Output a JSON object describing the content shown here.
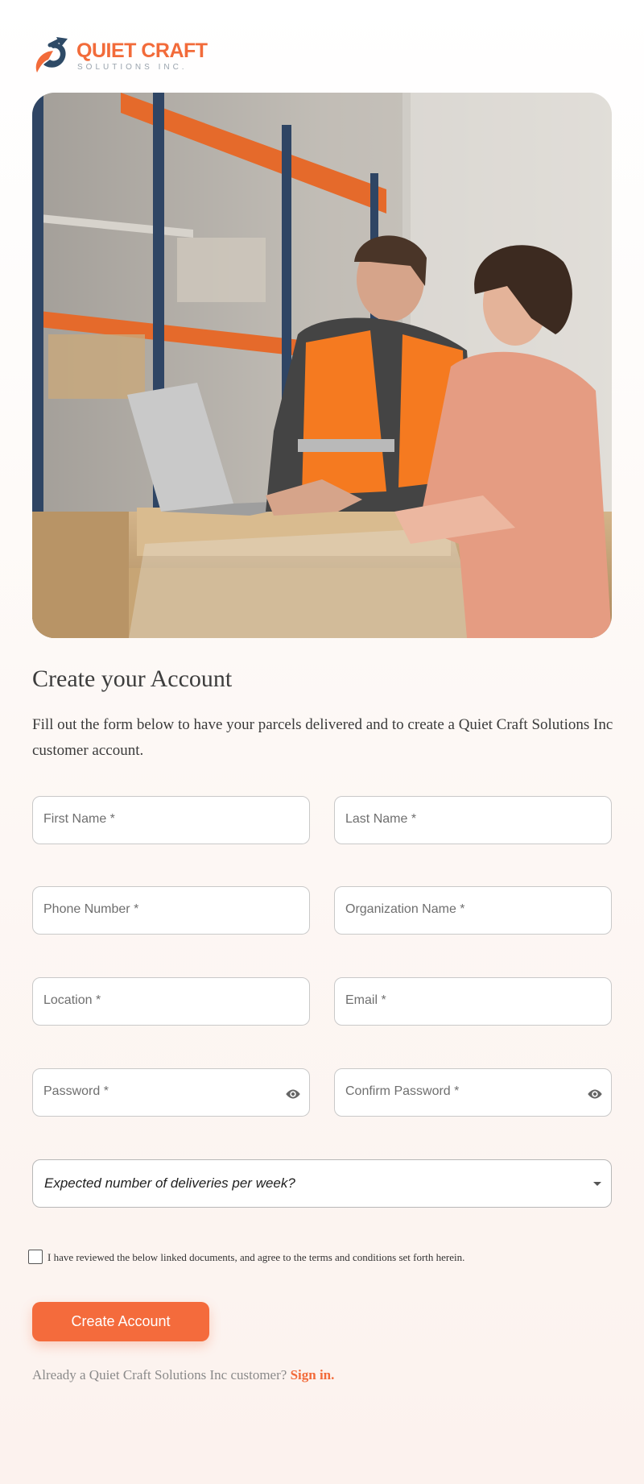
{
  "brand": {
    "name": "QUIET CRAFT",
    "tagline": "SOLUTIONS INC.",
    "accent_color": "#f26b3a",
    "secondary_color": "#2e4a66"
  },
  "hero": {
    "icon": "warehouse-photo"
  },
  "form": {
    "title": "Create your Account",
    "description": "Fill out the form below to have your parcels delivered and to create a Quiet Craft Solutions Inc customer account.",
    "fields": {
      "first_name": "First Name *",
      "last_name": "Last Name *",
      "phone": "Phone Number *",
      "organization": "Organization Name *",
      "location": "Location *",
      "email": "Email *",
      "password": "Password *",
      "confirm_password": "Confirm Password *"
    },
    "deliveries_select": {
      "selected": "Expected number of deliveries per week?"
    },
    "terms_text": "I have reviewed the below linked documents, and agree to the terms and conditions set forth herein.",
    "submit_label": "Create Account",
    "signin_prompt": "Already a Quiet Craft Solutions Inc customer?",
    "signin_link": "Sign in.",
    "button_color": "#f46b3c"
  }
}
